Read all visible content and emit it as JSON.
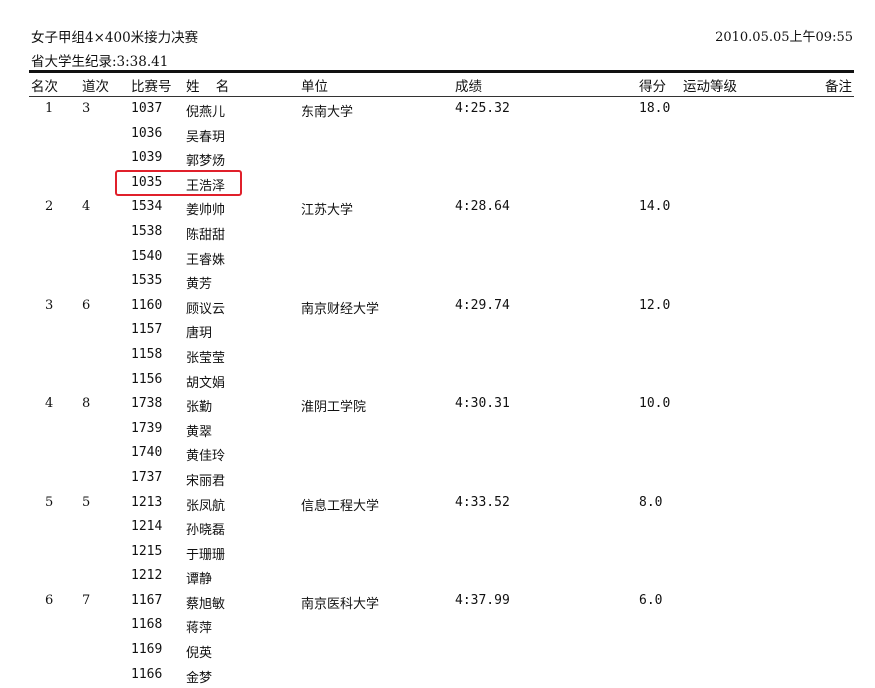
{
  "header": {
    "title": "女子甲组4×400米接力决赛",
    "datetime": "2010.05.05上午09:55",
    "record": "省大学生纪录:3:38.41"
  },
  "columns": {
    "rank": "名次",
    "lane": "道次",
    "bib": "比赛号",
    "name": "姓 名",
    "unit": "单位",
    "result": "成绩",
    "points": "得分",
    "level": "运动等级",
    "notes": "备注"
  },
  "teams": [
    {
      "rank": "1",
      "lane": "3",
      "unit": "东南大学",
      "result": "4:25.32",
      "points": "18.0",
      "members": [
        {
          "bib": "1037",
          "name": "倪燕儿"
        },
        {
          "bib": "1036",
          "name": "吴春玥"
        },
        {
          "bib": "1039",
          "name": "郭梦炀"
        },
        {
          "bib": "1035",
          "name": "王浩泽"
        }
      ]
    },
    {
      "rank": "2",
      "lane": "4",
      "unit": "江苏大学",
      "result": "4:28.64",
      "points": "14.0",
      "members": [
        {
          "bib": "1534",
          "name": "姜帅帅"
        },
        {
          "bib": "1538",
          "name": "陈甜甜"
        },
        {
          "bib": "1540",
          "name": "王睿姝"
        },
        {
          "bib": "1535",
          "name": "黄芳"
        }
      ]
    },
    {
      "rank": "3",
      "lane": "6",
      "unit": "南京财经大学",
      "result": "4:29.74",
      "points": "12.0",
      "members": [
        {
          "bib": "1160",
          "name": "顾议云"
        },
        {
          "bib": "1157",
          "name": "唐玥"
        },
        {
          "bib": "1158",
          "name": "张莹莹"
        },
        {
          "bib": "1156",
          "name": "胡文娟"
        }
      ]
    },
    {
      "rank": "4",
      "lane": "8",
      "unit": "淮阴工学院",
      "result": "4:30.31",
      "points": "10.0",
      "members": [
        {
          "bib": "1738",
          "name": "张勤"
        },
        {
          "bib": "1739",
          "name": "黄翠"
        },
        {
          "bib": "1740",
          "name": "黄佳玲"
        },
        {
          "bib": "1737",
          "name": "宋丽君"
        }
      ]
    },
    {
      "rank": "5",
      "lane": "5",
      "unit": "信息工程大学",
      "result": "4:33.52",
      "points": "8.0",
      "members": [
        {
          "bib": "1213",
          "name": "张凤航"
        },
        {
          "bib": "1214",
          "name": "孙晓磊"
        },
        {
          "bib": "1215",
          "name": "于珊珊"
        },
        {
          "bib": "1212",
          "name": "谭静"
        }
      ]
    },
    {
      "rank": "6",
      "lane": "7",
      "unit": "南京医科大学",
      "result": "4:37.99",
      "points": "6.0",
      "members": [
        {
          "bib": "1167",
          "name": "蔡旭敏"
        },
        {
          "bib": "1168",
          "name": "蒋萍"
        },
        {
          "bib": "1169",
          "name": "倪英"
        },
        {
          "bib": "1166",
          "name": "金梦"
        }
      ]
    }
  ],
  "highlight_color": "#e0202b"
}
